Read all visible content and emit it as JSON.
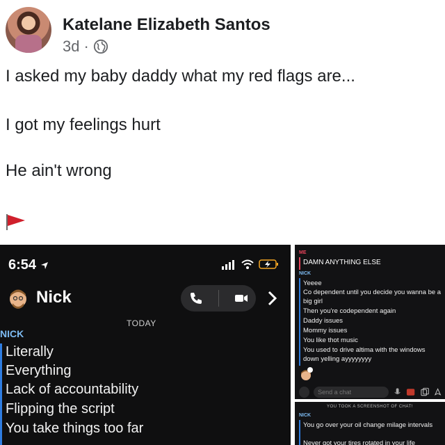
{
  "post": {
    "author": "Katelane Elizabeth Santos",
    "time": "3d",
    "separator": "·",
    "icons": {
      "privacy": "globe-icon",
      "flag": "red-flag-icon"
    },
    "lines": [
      "I asked my baby daddy what my red flags are...",
      "I got my feelings hurt",
      "He ain't wrong"
    ]
  },
  "left_screenshot": {
    "status_time": "6:54",
    "contact_name": "Nick",
    "date_divider": "TODAY",
    "sender": "NICK",
    "messages": [
      "Literally",
      "Everything",
      "Lack of accountability",
      "Flipping the script",
      "You take things too far"
    ]
  },
  "right_top_screenshot": {
    "me_label": "ME",
    "me_message": "DAMN ANYTHING ELSE",
    "sender": "NICK",
    "messages": [
      "Yeeee",
      "Co dependent until you decide you wanna be a big girl",
      "Then you're codependent again",
      "Daddy issues",
      "Mommy issues",
      "You like thot music",
      "You used to drive altima with the windows down yelling ayyyyyyyy"
    ],
    "input_placeholder": "Send a chat"
  },
  "right_bottom_screenshot": {
    "notice": "YOU TOOK A SCREENSHOT OF CHAT!",
    "sender": "NICK",
    "messages": [
      "You go over your oil change milage intervals",
      "Never got your tires rotated in your life"
    ]
  },
  "colors": {
    "accent_blue": "#2f7de1",
    "me_red": "#e9425a",
    "flag_red": "#d0202c"
  }
}
